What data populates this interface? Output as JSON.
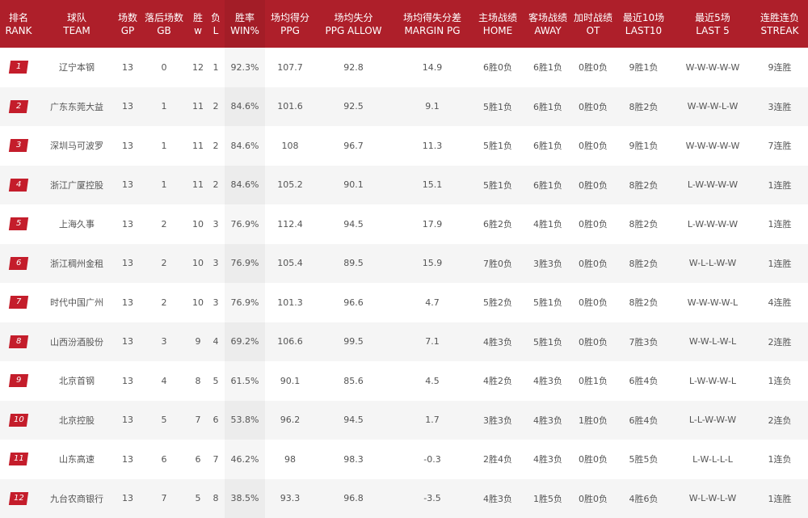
{
  "columns": [
    {
      "cn": "排名",
      "en": "RANK"
    },
    {
      "cn": "球队",
      "en": "TEAM"
    },
    {
      "cn": "场数",
      "en": "GP"
    },
    {
      "cn": "落后场数",
      "en": "GB"
    },
    {
      "cn": "胜",
      "en": "w"
    },
    {
      "cn": "负",
      "en": "L"
    },
    {
      "cn": "胜率",
      "en": "WIN%"
    },
    {
      "cn": "场均得分",
      "en": "PPG"
    },
    {
      "cn": "场均失分",
      "en": "PPG ALLOW"
    },
    {
      "cn": "场均得失分差",
      "en": "MARGIN PG"
    },
    {
      "cn": "主场战绩",
      "en": "HOME"
    },
    {
      "cn": "客场战绩",
      "en": "AWAY"
    },
    {
      "cn": "加时战绩",
      "en": "OT"
    },
    {
      "cn": "最近10场",
      "en": "LAST10"
    },
    {
      "cn": "最近5场",
      "en": "LAST 5"
    },
    {
      "cn": "连胜连负",
      "en": "STREAK"
    }
  ],
  "rows": [
    {
      "rank": "1",
      "team": "辽宁本钢",
      "gp": "13",
      "gb": "0",
      "w": "12",
      "l": "1",
      "win": "92.3%",
      "ppg": "107.7",
      "allow": "92.8",
      "margin": "14.9",
      "home": "6胜0负",
      "away": "6胜1负",
      "ot": "0胜0负",
      "last10": "9胜1负",
      "last5": "W-W-W-W-W",
      "streak": "9连胜"
    },
    {
      "rank": "2",
      "team": "广东东莞大益",
      "gp": "13",
      "gb": "1",
      "w": "11",
      "l": "2",
      "win": "84.6%",
      "ppg": "101.6",
      "allow": "92.5",
      "margin": "9.1",
      "home": "5胜1负",
      "away": "6胜1负",
      "ot": "0胜0负",
      "last10": "8胜2负",
      "last5": "W-W-W-L-W",
      "streak": "3连胜"
    },
    {
      "rank": "3",
      "team": "深圳马可波罗",
      "gp": "13",
      "gb": "1",
      "w": "11",
      "l": "2",
      "win": "84.6%",
      "ppg": "108",
      "allow": "96.7",
      "margin": "11.3",
      "home": "5胜1负",
      "away": "6胜1负",
      "ot": "0胜0负",
      "last10": "9胜1负",
      "last5": "W-W-W-W-W",
      "streak": "7连胜"
    },
    {
      "rank": "4",
      "team": "浙江广厦控股",
      "gp": "13",
      "gb": "1",
      "w": "11",
      "l": "2",
      "win": "84.6%",
      "ppg": "105.2",
      "allow": "90.1",
      "margin": "15.1",
      "home": "5胜1负",
      "away": "6胜1负",
      "ot": "0胜0负",
      "last10": "8胜2负",
      "last5": "L-W-W-W-W",
      "streak": "1连胜"
    },
    {
      "rank": "5",
      "team": "上海久事",
      "gp": "13",
      "gb": "2",
      "w": "10",
      "l": "3",
      "win": "76.9%",
      "ppg": "112.4",
      "allow": "94.5",
      "margin": "17.9",
      "home": "6胜2负",
      "away": "4胜1负",
      "ot": "0胜0负",
      "last10": "8胜2负",
      "last5": "L-W-W-W-W",
      "streak": "1连胜"
    },
    {
      "rank": "6",
      "team": "浙江稠州金租",
      "gp": "13",
      "gb": "2",
      "w": "10",
      "l": "3",
      "win": "76.9%",
      "ppg": "105.4",
      "allow": "89.5",
      "margin": "15.9",
      "home": "7胜0负",
      "away": "3胜3负",
      "ot": "0胜0负",
      "last10": "8胜2负",
      "last5": "W-L-L-W-W",
      "streak": "1连胜"
    },
    {
      "rank": "7",
      "team": "时代中国广州",
      "gp": "13",
      "gb": "2",
      "w": "10",
      "l": "3",
      "win": "76.9%",
      "ppg": "101.3",
      "allow": "96.6",
      "margin": "4.7",
      "home": "5胜2负",
      "away": "5胜1负",
      "ot": "0胜0负",
      "last10": "8胜2负",
      "last5": "W-W-W-W-L",
      "streak": "4连胜"
    },
    {
      "rank": "8",
      "team": "山西汾酒股份",
      "gp": "13",
      "gb": "3",
      "w": "9",
      "l": "4",
      "win": "69.2%",
      "ppg": "106.6",
      "allow": "99.5",
      "margin": "7.1",
      "home": "4胜3负",
      "away": "5胜1负",
      "ot": "0胜0负",
      "last10": "7胜3负",
      "last5": "W-W-L-W-L",
      "streak": "2连胜"
    },
    {
      "rank": "9",
      "team": "北京首钢",
      "gp": "13",
      "gb": "4",
      "w": "8",
      "l": "5",
      "win": "61.5%",
      "ppg": "90.1",
      "allow": "85.6",
      "margin": "4.5",
      "home": "4胜2负",
      "away": "4胜3负",
      "ot": "0胜1负",
      "last10": "6胜4负",
      "last5": "L-W-W-W-L",
      "streak": "1连负"
    },
    {
      "rank": "10",
      "team": "北京控股",
      "gp": "13",
      "gb": "5",
      "w": "7",
      "l": "6",
      "win": "53.8%",
      "ppg": "96.2",
      "allow": "94.5",
      "margin": "1.7",
      "home": "3胜3负",
      "away": "4胜3负",
      "ot": "1胜0负",
      "last10": "6胜4负",
      "last5": "L-L-W-W-W",
      "streak": "2连负"
    },
    {
      "rank": "11",
      "team": "山东高速",
      "gp": "13",
      "gb": "6",
      "w": "6",
      "l": "7",
      "win": "46.2%",
      "ppg": "98",
      "allow": "98.3",
      "margin": "-0.3",
      "home": "2胜4负",
      "away": "4胜3负",
      "ot": "0胜0负",
      "last10": "5胜5负",
      "last5": "L-W-L-L-L",
      "streak": "1连负"
    },
    {
      "rank": "12",
      "team": "九台农商银行",
      "gp": "13",
      "gb": "7",
      "w": "5",
      "l": "8",
      "win": "38.5%",
      "ppg": "93.3",
      "allow": "96.8",
      "margin": "-3.5",
      "home": "4胜3负",
      "away": "1胜5负",
      "ot": "0胜0负",
      "last10": "4胜6负",
      "last5": "W-L-W-L-W",
      "streak": "1连胜"
    }
  ],
  "colors": {
    "header_bg": "#ae1f2a",
    "badge_bg": "#c41d2b",
    "row_alt": "#f5f5f5",
    "text": "#555555"
  }
}
